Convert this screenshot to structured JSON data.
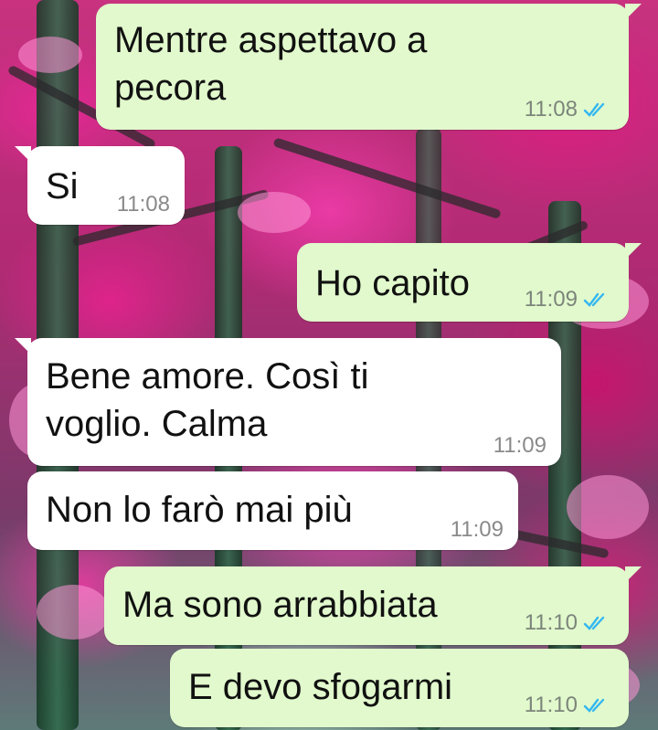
{
  "colors": {
    "outgoing_bubble": "#e1f9cc",
    "incoming_bubble": "#ffffff",
    "read_tick": "#34b7f1",
    "text": "#111111",
    "time": "#7c857b"
  },
  "wallpaper": {
    "description_icon": "pink-forest-wallpaper"
  },
  "messages": [
    {
      "direction": "outgoing",
      "text": "Mentre aspettavo a\npecora",
      "time": "11:08",
      "status": "read"
    },
    {
      "direction": "incoming",
      "text": "Si",
      "time": "11:08"
    },
    {
      "direction": "outgoing",
      "text": "Ho capito",
      "time": "11:09",
      "status": "read"
    },
    {
      "direction": "incoming",
      "text": "Bene amore. Così ti\nvoglio. Calma",
      "time": "11:09"
    },
    {
      "direction": "incoming",
      "text": "Non lo farò mai più",
      "time": "11:09"
    },
    {
      "direction": "outgoing",
      "text": "Ma sono arrabbiata",
      "time": "11:10",
      "status": "read"
    },
    {
      "direction": "outgoing",
      "text": "E devo sfogarmi",
      "time": "11:10",
      "status": "read"
    }
  ]
}
